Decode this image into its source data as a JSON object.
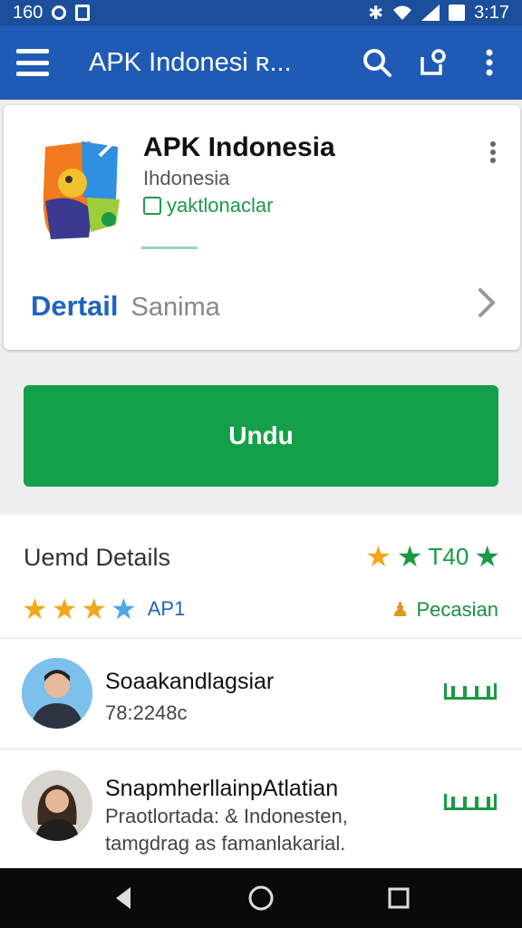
{
  "status_bar": {
    "time_left": "160",
    "time_right": "3:17"
  },
  "app_bar": {
    "title": "APK Indonesi ʀ..."
  },
  "app_card": {
    "name": "APK Indonesia",
    "developer": "Ihdonesia",
    "link_text": "yaktlonaclar",
    "tab_detail": "Dertail",
    "tab_secondary": "Sanima"
  },
  "download_label": "Undu",
  "details": {
    "title": "Uemd Details",
    "rating_value": "T40",
    "api_label": "AP1",
    "permission_label": "Pecasian",
    "stars_filled": 3.5
  },
  "reviews": [
    {
      "name": "Soaakandlagsiar",
      "text": "78:2248c"
    },
    {
      "name": "SnapmherllainpAtlatian",
      "text": "Praotlortada: & Indonesten,\ntamgdrag as famanlakarial."
    }
  ],
  "colors": {
    "primary": "#1f5bb5",
    "accent_green": "#14a048",
    "star": "#f2a61a"
  }
}
